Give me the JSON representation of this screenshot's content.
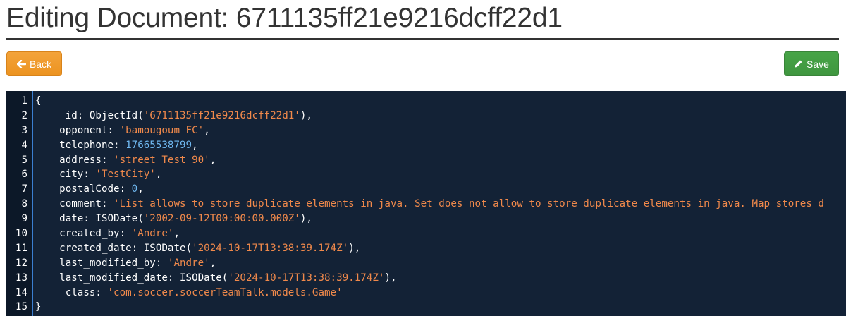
{
  "header": {
    "title": "Editing Document: 6711135ff21e9216dcff22d1"
  },
  "toolbar": {
    "back_label": "Back",
    "back_icon": "arrow-left-icon",
    "save_label": "Save",
    "save_icon": "pencil-icon",
    "back_color": "#f0a030",
    "save_color": "#44a044"
  },
  "editor": {
    "background": "#132236",
    "string_color": "#f0894b",
    "number_color": "#6fb8f0",
    "lines": [
      {
        "num": "1",
        "tokens": [
          {
            "t": "{",
            "k": "p"
          }
        ]
      },
      {
        "num": "2",
        "tokens": [
          {
            "t": "    _id: ObjectId(",
            "k": "p"
          },
          {
            "t": "'6711135ff21e9216dcff22d1'",
            "k": "s"
          },
          {
            "t": "),",
            "k": "p"
          }
        ]
      },
      {
        "num": "3",
        "tokens": [
          {
            "t": "    opponent: ",
            "k": "p"
          },
          {
            "t": "'bamougoum FC'",
            "k": "s"
          },
          {
            "t": ",",
            "k": "p"
          }
        ]
      },
      {
        "num": "4",
        "tokens": [
          {
            "t": "    telephone: ",
            "k": "p"
          },
          {
            "t": "17665538799",
            "k": "n"
          },
          {
            "t": ",",
            "k": "p"
          }
        ]
      },
      {
        "num": "5",
        "tokens": [
          {
            "t": "    address: ",
            "k": "p"
          },
          {
            "t": "'street Test 90'",
            "k": "s"
          },
          {
            "t": ",",
            "k": "p"
          }
        ]
      },
      {
        "num": "6",
        "tokens": [
          {
            "t": "    city: ",
            "k": "p"
          },
          {
            "t": "'TestCity'",
            "k": "s"
          },
          {
            "t": ",",
            "k": "p"
          }
        ]
      },
      {
        "num": "7",
        "tokens": [
          {
            "t": "    postalCode: ",
            "k": "p"
          },
          {
            "t": "0",
            "k": "n"
          },
          {
            "t": ",",
            "k": "p"
          }
        ]
      },
      {
        "num": "8",
        "tokens": [
          {
            "t": "    comment: ",
            "k": "p"
          },
          {
            "t": "'List allows to store duplicate elements in java. Set does not allow to store duplicate elements in java. Map stores d",
            "k": "s"
          }
        ]
      },
      {
        "num": "9",
        "tokens": [
          {
            "t": "    date: ISODate(",
            "k": "p"
          },
          {
            "t": "'2002-09-12T00:00:00.000Z'",
            "k": "s"
          },
          {
            "t": "),",
            "k": "p"
          }
        ]
      },
      {
        "num": "10",
        "tokens": [
          {
            "t": "    created_by: ",
            "k": "p"
          },
          {
            "t": "'Andre'",
            "k": "s"
          },
          {
            "t": ",",
            "k": "p"
          }
        ]
      },
      {
        "num": "11",
        "tokens": [
          {
            "t": "    created_date: ISODate(",
            "k": "p"
          },
          {
            "t": "'2024-10-17T13:38:39.174Z'",
            "k": "s"
          },
          {
            "t": "),",
            "k": "p"
          }
        ]
      },
      {
        "num": "12",
        "tokens": [
          {
            "t": "    last_modified_by: ",
            "k": "p"
          },
          {
            "t": "'Andre'",
            "k": "s"
          },
          {
            "t": ",",
            "k": "p"
          }
        ]
      },
      {
        "num": "13",
        "tokens": [
          {
            "t": "    last_modified_date: ISODate(",
            "k": "p"
          },
          {
            "t": "'2024-10-17T13:38:39.174Z'",
            "k": "s"
          },
          {
            "t": "),",
            "k": "p"
          }
        ]
      },
      {
        "num": "14",
        "tokens": [
          {
            "t": "    _class: ",
            "k": "p"
          },
          {
            "t": "'com.soccer.soccerTeamTalk.models.Game'",
            "k": "s"
          }
        ]
      },
      {
        "num": "15",
        "tokens": [
          {
            "t": "}",
            "k": "p"
          }
        ]
      }
    ]
  }
}
